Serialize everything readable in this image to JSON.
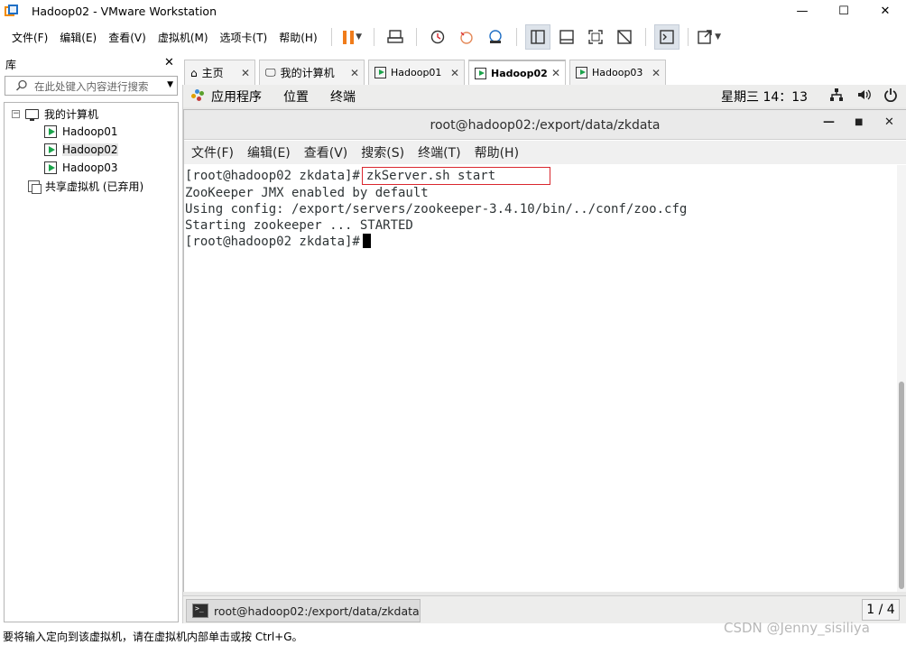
{
  "window": {
    "title": "Hadoop02 - VMware Workstation"
  },
  "menu": [
    "文件(F)",
    "编辑(E)",
    "查看(V)",
    "虚拟机(M)",
    "选项卡(T)",
    "帮助(H)"
  ],
  "library": {
    "title": "库",
    "search_placeholder": "在此处键入内容进行搜索",
    "tree": {
      "root": "我的计算机",
      "vms": [
        "Hadoop01",
        "Hadoop02",
        "Hadoop03"
      ],
      "shared": "共享虚拟机 (已弃用)"
    }
  },
  "tabs": [
    {
      "label": "主页"
    },
    {
      "label": "我的计算机"
    },
    {
      "label": "Hadoop01"
    },
    {
      "label": "Hadoop02"
    },
    {
      "label": "Hadoop03"
    }
  ],
  "guest": {
    "topbar": {
      "apps": "应用程序",
      "places": "位置",
      "terminal": "终端",
      "clock": "星期三 14：13"
    },
    "terminal": {
      "title": "root@hadoop02:/export/data/zkdata",
      "menu": [
        "文件(F)",
        "编辑(E)",
        "查看(V)",
        "搜索(S)",
        "终端(T)",
        "帮助(H)"
      ],
      "prompt": "[root@hadoop02 zkdata]#",
      "command": "zkServer.sh start",
      "lines": [
        "ZooKeeper JMX enabled by default",
        "Using config: /export/servers/zookeeper-3.4.10/bin/../conf/zoo.cfg",
        "Starting zookeeper ... STARTED"
      ]
    },
    "taskbar": {
      "item": "root@hadoop02:/export/data/zkdata",
      "workspace": "1 / 4"
    }
  },
  "statusbar": {
    "text": "要将输入定向到该虚拟机，请在虚拟机内部单击或按 Ctrl+G。",
    "watermark": "CSDN @Jenny_sisiliya"
  }
}
